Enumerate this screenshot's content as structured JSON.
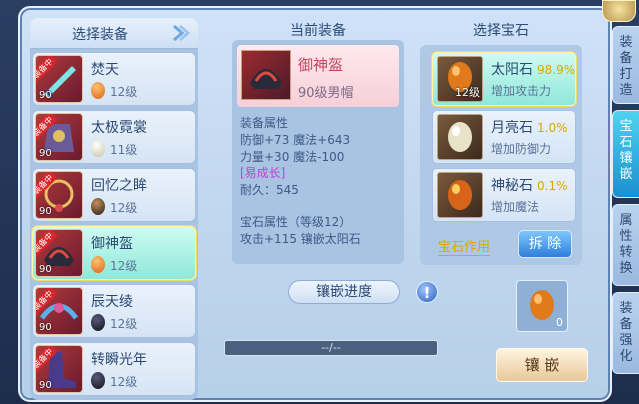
{
  "left": {
    "title": "选择装备",
    "items": [
      {
        "name": "焚天",
        "level": "90",
        "gem_level": "12级",
        "tag": "装备中",
        "gem_color": "#e07a1a"
      },
      {
        "name": "太极霓裳",
        "level": "90",
        "gem_level": "11级",
        "tag": "装备中",
        "gem_color": "#e8e3c8"
      },
      {
        "name": "回忆之眸",
        "level": "90",
        "gem_level": "12级",
        "tag": "装备中",
        "gem_color": "#3a2a1c"
      },
      {
        "name": "御神盔",
        "level": "90",
        "gem_level": "12级",
        "tag": "装备中",
        "gem_color": "#e07a1a"
      },
      {
        "name": "辰天绫",
        "level": "90",
        "gem_level": "12级",
        "tag": "装备中",
        "gem_color": "#1a1a2a"
      },
      {
        "name": "转瞬光年",
        "level": "90",
        "gem_level": "12级",
        "tag": "装备中",
        "gem_color": "#1a1a2a"
      }
    ]
  },
  "middle": {
    "title": "当前装备",
    "equip_name": "御神盔",
    "equip_type": "90级男帽",
    "attr_title": "装备属性",
    "attr_line1": "防御+73 魔法+643",
    "attr_line2": "力量+30 魔法-100",
    "growth": "[易成长]",
    "durability": "耐久：545",
    "gem_attr_title": "宝石属性（等级12）",
    "gem_attr_line": "攻击+115 镶嵌太阳石",
    "progress_label": "镶嵌进度",
    "progress_text": "--/--",
    "progress_fraction": 0
  },
  "right": {
    "title": "选择宝石",
    "gems": [
      {
        "name": "太阳石",
        "rate": "98.9%",
        "desc": "增加攻击力",
        "level": "12级",
        "color": "#e07a1a"
      },
      {
        "name": "月亮石",
        "rate": "1.0%",
        "desc": "增加防御力",
        "level": "",
        "color": "#e8e3c8"
      },
      {
        "name": "神秘石",
        "rate": "0.1%",
        "desc": "增加魔法",
        "level": "",
        "color": "#d8641a"
      }
    ],
    "gem_effect_label": "宝石作用",
    "remove_label": "拆 除",
    "slot_count": "0",
    "inlay_label": "镶 嵌"
  },
  "tabs": [
    "装备打造",
    "宝石镶嵌",
    "属性转换",
    "装备强化"
  ],
  "colors": {
    "accent": "#2f7fd9",
    "highlight": "#f3d86a",
    "rate": "#e0a400",
    "growth": "#c13fd6"
  }
}
